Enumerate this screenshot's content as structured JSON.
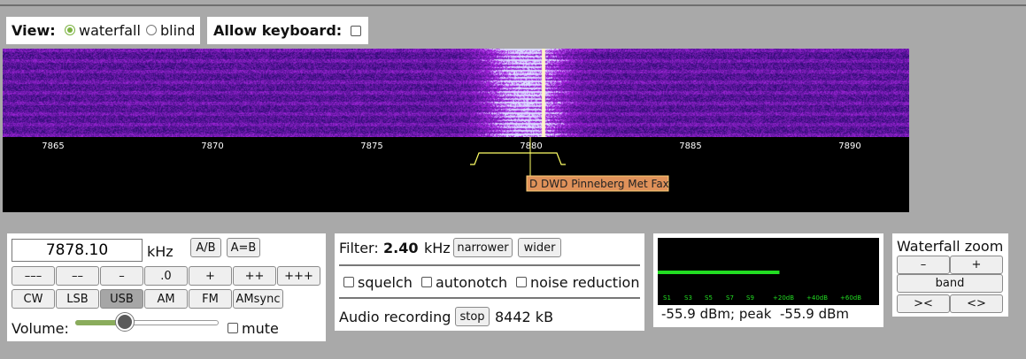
{
  "view": {
    "label": "View:",
    "options": [
      {
        "label": "waterfall",
        "selected": true
      },
      {
        "label": "blind",
        "selected": false
      }
    ]
  },
  "keyboard": {
    "label": "Allow keyboard:",
    "checked": false
  },
  "scale": {
    "ticks": [
      "7865",
      "7870",
      "7875",
      "7880",
      "7885",
      "7890"
    ],
    "station_label": "D DWD Pinneberg Met Fax"
  },
  "frequency": {
    "value": "7878.10",
    "unit": "kHz",
    "ab_label": "A/B",
    "aeqb_label": "A=B",
    "step_buttons": [
      "–––",
      "––",
      "–",
      ".0",
      "+",
      "++",
      "+++"
    ],
    "modes": [
      "CW",
      "LSB",
      "USB",
      "AM",
      "FM",
      "AMsync"
    ],
    "selected_mode": "USB",
    "volume_label": "Volume:",
    "volume_level": 0.35,
    "mute_label": "mute",
    "mute_checked": false
  },
  "filter": {
    "label": "Filter:",
    "bandwidth": "2.40",
    "unit": "kHz",
    "narrower_label": "narrower",
    "wider_label": "wider",
    "options": [
      {
        "label": "squelch",
        "checked": false
      },
      {
        "label": "autonotch",
        "checked": false
      },
      {
        "label": "noise reduction",
        "checked": false
      }
    ],
    "recording_label": "Audio recording",
    "stop_label": "stop",
    "recording_size": "8442 kB"
  },
  "smeter": {
    "scale_labels": [
      "S1",
      "S3",
      "S5",
      "S7",
      "S9",
      "+20dB",
      "+40dB",
      "+60dB"
    ],
    "level_fraction": 0.55,
    "readout": "-55.9 dBm; peak  -55.9 dBm"
  },
  "zoom": {
    "title": "Waterfall zoom",
    "minus_label": "–",
    "plus_label": "+",
    "band_label": "band",
    "left_label": "><",
    "right_label": "<>"
  },
  "colors": {
    "waterfall_bg": "#3a0f8a",
    "carrier": "#fff4c8",
    "passband": "#ffff66",
    "station_label_bg": "#e0925a",
    "smeter_bar": "#22dd22",
    "radio_selected": "#7cb342"
  }
}
